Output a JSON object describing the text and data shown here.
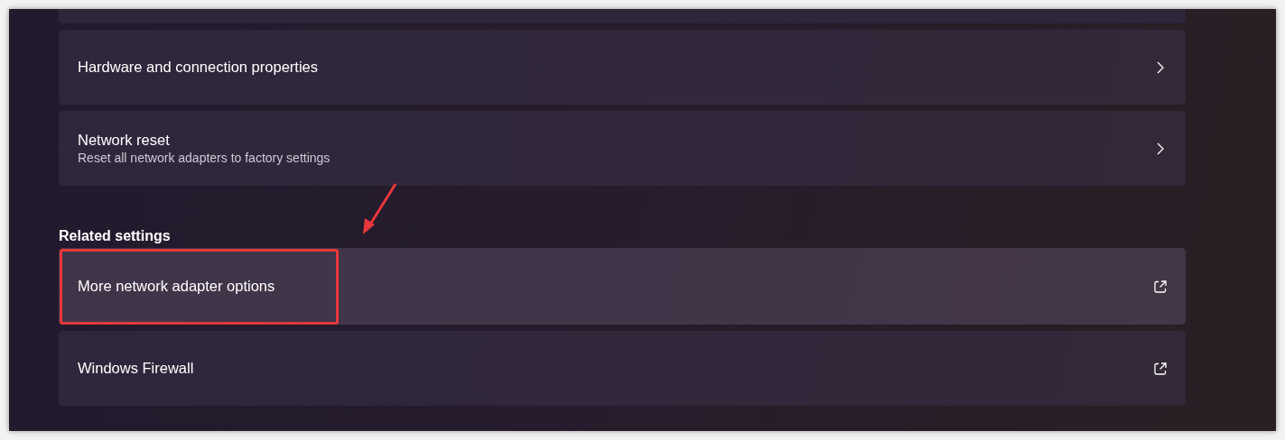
{
  "sections": [
    {
      "items": [
        {
          "title": "Hardware and connection properties",
          "kind": "chevron",
          "hovered": false,
          "highlighted": false
        },
        {
          "title": "Network reset",
          "subtitle": "Reset all network adapters to factory settings",
          "kind": "chevron",
          "hovered": false,
          "highlighted": false
        }
      ]
    },
    {
      "heading": "Related settings",
      "items": [
        {
          "title": "More network adapter options",
          "kind": "external",
          "hovered": true,
          "highlighted": true
        },
        {
          "title": "Windows Firewall",
          "kind": "external",
          "hovered": false,
          "highlighted": false
        }
      ]
    }
  ]
}
